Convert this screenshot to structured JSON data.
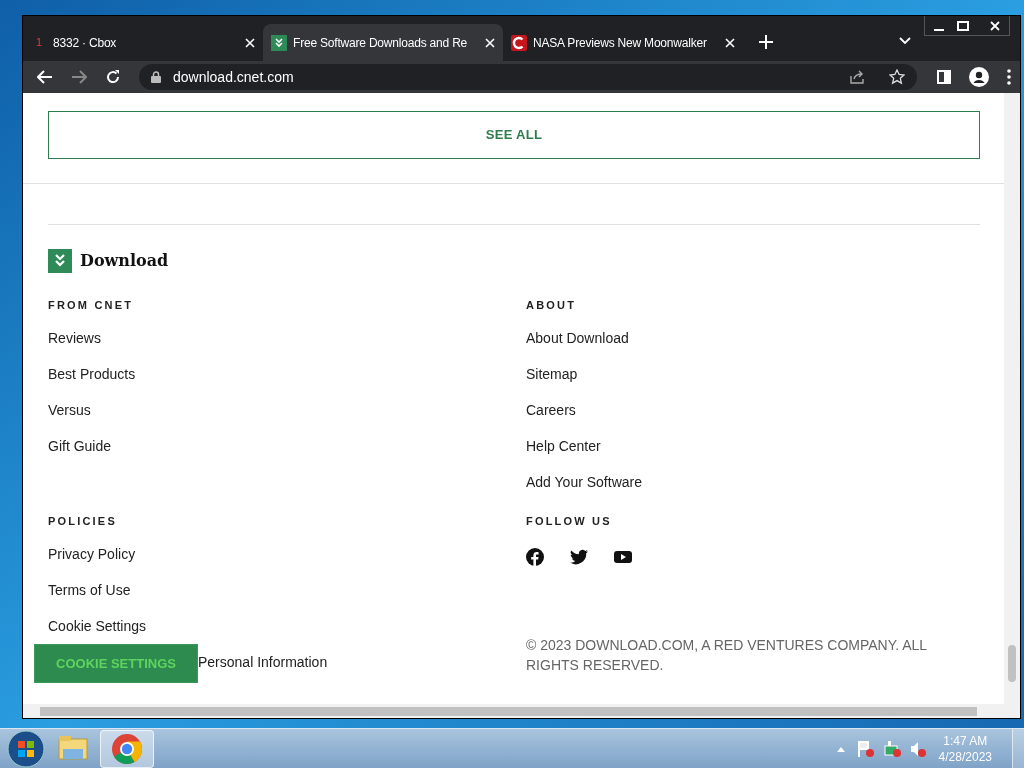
{
  "browser": {
    "tabs": [
      {
        "title": "8332 · Cbox",
        "kind": "cbox",
        "favicon_text": "1",
        "selected": false
      },
      {
        "title": "Free Software Downloads and Re",
        "kind": "download",
        "selected": true
      },
      {
        "title": "NASA Previews New Moonwalker",
        "kind": "cnet",
        "selected": false
      }
    ],
    "address": "download.cnet.com"
  },
  "page": {
    "see_all": "SEE ALL",
    "logo": "Download",
    "sections": [
      {
        "heading": "FROM CNET",
        "links": [
          "Reviews",
          "Best Products",
          "Versus",
          "Gift Guide"
        ]
      },
      {
        "heading": "ABOUT",
        "links": [
          "About Download",
          "Sitemap",
          "Careers",
          "Help Center",
          "Add Your Software"
        ]
      },
      {
        "heading": "POLICIES",
        "links": [
          "Privacy Policy",
          "Terms of Use",
          "Cookie Settings",
          "Personal Information"
        ]
      },
      {
        "heading": "FOLLOW US",
        "social": [
          {
            "kind": "facebook"
          },
          {
            "kind": "twitter"
          },
          {
            "kind": "youtube"
          }
        ],
        "copyright": "© 2023 DOWNLOAD.COM, A RED VENTURES COMPANY. ALL RIGHTS RESERVED."
      }
    ],
    "cookie_button": "COOKIE SETTINGS"
  },
  "taskbar": {
    "apps": [
      {
        "kind": "explorer",
        "selected": false
      },
      {
        "kind": "chrome",
        "selected": true
      }
    ],
    "time": "1:47 AM",
    "date": "4/28/2023"
  }
}
